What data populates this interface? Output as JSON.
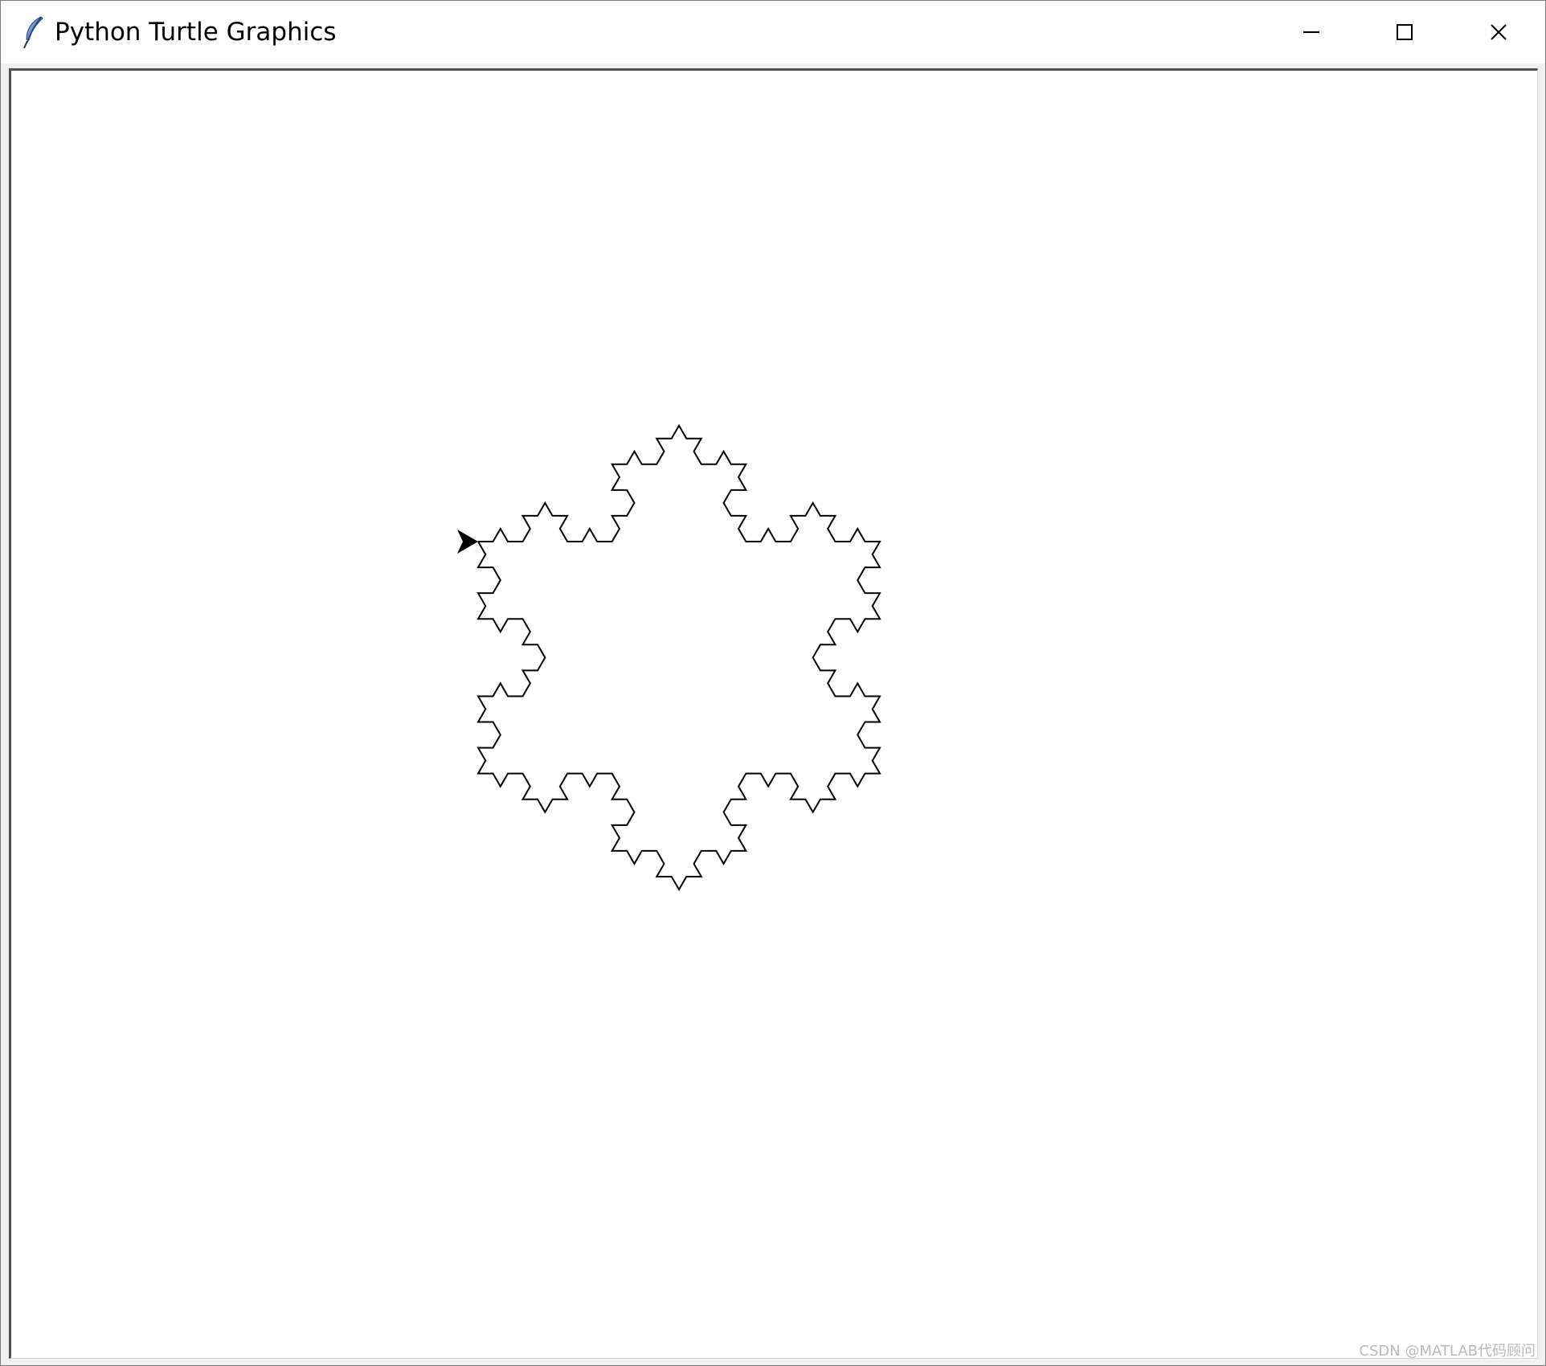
{
  "window": {
    "title": "Python Turtle Graphics",
    "icon": "feather-icon",
    "controls": {
      "minimize": "minimize-icon",
      "maximize": "maximize-icon",
      "close": "close-icon"
    }
  },
  "canvas": {
    "background": "#ffffff",
    "drawing": {
      "shape": "koch-snowflake",
      "recursion_depth": 3,
      "line_color": "#000000",
      "turtle_color": "#000000",
      "turtle_heading": "east"
    }
  },
  "watermark": {
    "text": "CSDN @MATLAB代码顾问"
  }
}
